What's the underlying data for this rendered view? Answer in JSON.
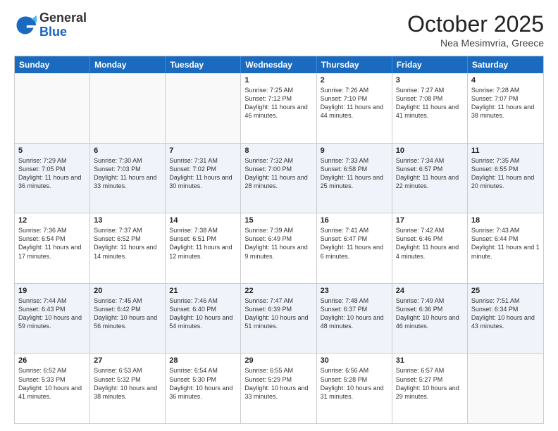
{
  "header": {
    "logo_general": "General",
    "logo_blue": "Blue",
    "month_title": "October 2025",
    "location": "Nea Mesimvria, Greece"
  },
  "days_of_week": [
    "Sunday",
    "Monday",
    "Tuesday",
    "Wednesday",
    "Thursday",
    "Friday",
    "Saturday"
  ],
  "weeks": [
    [
      {
        "day": "",
        "info": ""
      },
      {
        "day": "",
        "info": ""
      },
      {
        "day": "",
        "info": ""
      },
      {
        "day": "1",
        "info": "Sunrise: 7:25 AM\nSunset: 7:12 PM\nDaylight: 11 hours and 46 minutes."
      },
      {
        "day": "2",
        "info": "Sunrise: 7:26 AM\nSunset: 7:10 PM\nDaylight: 11 hours and 44 minutes."
      },
      {
        "day": "3",
        "info": "Sunrise: 7:27 AM\nSunset: 7:08 PM\nDaylight: 11 hours and 41 minutes."
      },
      {
        "day": "4",
        "info": "Sunrise: 7:28 AM\nSunset: 7:07 PM\nDaylight: 11 hours and 38 minutes."
      }
    ],
    [
      {
        "day": "5",
        "info": "Sunrise: 7:29 AM\nSunset: 7:05 PM\nDaylight: 11 hours and 36 minutes."
      },
      {
        "day": "6",
        "info": "Sunrise: 7:30 AM\nSunset: 7:03 PM\nDaylight: 11 hours and 33 minutes."
      },
      {
        "day": "7",
        "info": "Sunrise: 7:31 AM\nSunset: 7:02 PM\nDaylight: 11 hours and 30 minutes."
      },
      {
        "day": "8",
        "info": "Sunrise: 7:32 AM\nSunset: 7:00 PM\nDaylight: 11 hours and 28 minutes."
      },
      {
        "day": "9",
        "info": "Sunrise: 7:33 AM\nSunset: 6:58 PM\nDaylight: 11 hours and 25 minutes."
      },
      {
        "day": "10",
        "info": "Sunrise: 7:34 AM\nSunset: 6:57 PM\nDaylight: 11 hours and 22 minutes."
      },
      {
        "day": "11",
        "info": "Sunrise: 7:35 AM\nSunset: 6:55 PM\nDaylight: 11 hours and 20 minutes."
      }
    ],
    [
      {
        "day": "12",
        "info": "Sunrise: 7:36 AM\nSunset: 6:54 PM\nDaylight: 11 hours and 17 minutes."
      },
      {
        "day": "13",
        "info": "Sunrise: 7:37 AM\nSunset: 6:52 PM\nDaylight: 11 hours and 14 minutes."
      },
      {
        "day": "14",
        "info": "Sunrise: 7:38 AM\nSunset: 6:51 PM\nDaylight: 11 hours and 12 minutes."
      },
      {
        "day": "15",
        "info": "Sunrise: 7:39 AM\nSunset: 6:49 PM\nDaylight: 11 hours and 9 minutes."
      },
      {
        "day": "16",
        "info": "Sunrise: 7:41 AM\nSunset: 6:47 PM\nDaylight: 11 hours and 6 minutes."
      },
      {
        "day": "17",
        "info": "Sunrise: 7:42 AM\nSunset: 6:46 PM\nDaylight: 11 hours and 4 minutes."
      },
      {
        "day": "18",
        "info": "Sunrise: 7:43 AM\nSunset: 6:44 PM\nDaylight: 11 hours and 1 minute."
      }
    ],
    [
      {
        "day": "19",
        "info": "Sunrise: 7:44 AM\nSunset: 6:43 PM\nDaylight: 10 hours and 59 minutes."
      },
      {
        "day": "20",
        "info": "Sunrise: 7:45 AM\nSunset: 6:42 PM\nDaylight: 10 hours and 56 minutes."
      },
      {
        "day": "21",
        "info": "Sunrise: 7:46 AM\nSunset: 6:40 PM\nDaylight: 10 hours and 54 minutes."
      },
      {
        "day": "22",
        "info": "Sunrise: 7:47 AM\nSunset: 6:39 PM\nDaylight: 10 hours and 51 minutes."
      },
      {
        "day": "23",
        "info": "Sunrise: 7:48 AM\nSunset: 6:37 PM\nDaylight: 10 hours and 48 minutes."
      },
      {
        "day": "24",
        "info": "Sunrise: 7:49 AM\nSunset: 6:36 PM\nDaylight: 10 hours and 46 minutes."
      },
      {
        "day": "25",
        "info": "Sunrise: 7:51 AM\nSunset: 6:34 PM\nDaylight: 10 hours and 43 minutes."
      }
    ],
    [
      {
        "day": "26",
        "info": "Sunrise: 6:52 AM\nSunset: 5:33 PM\nDaylight: 10 hours and 41 minutes."
      },
      {
        "day": "27",
        "info": "Sunrise: 6:53 AM\nSunset: 5:32 PM\nDaylight: 10 hours and 38 minutes."
      },
      {
        "day": "28",
        "info": "Sunrise: 6:54 AM\nSunset: 5:30 PM\nDaylight: 10 hours and 36 minutes."
      },
      {
        "day": "29",
        "info": "Sunrise: 6:55 AM\nSunset: 5:29 PM\nDaylight: 10 hours and 33 minutes."
      },
      {
        "day": "30",
        "info": "Sunrise: 6:56 AM\nSunset: 5:28 PM\nDaylight: 10 hours and 31 minutes."
      },
      {
        "day": "31",
        "info": "Sunrise: 6:57 AM\nSunset: 5:27 PM\nDaylight: 10 hours and 29 minutes."
      },
      {
        "day": "",
        "info": ""
      }
    ]
  ]
}
